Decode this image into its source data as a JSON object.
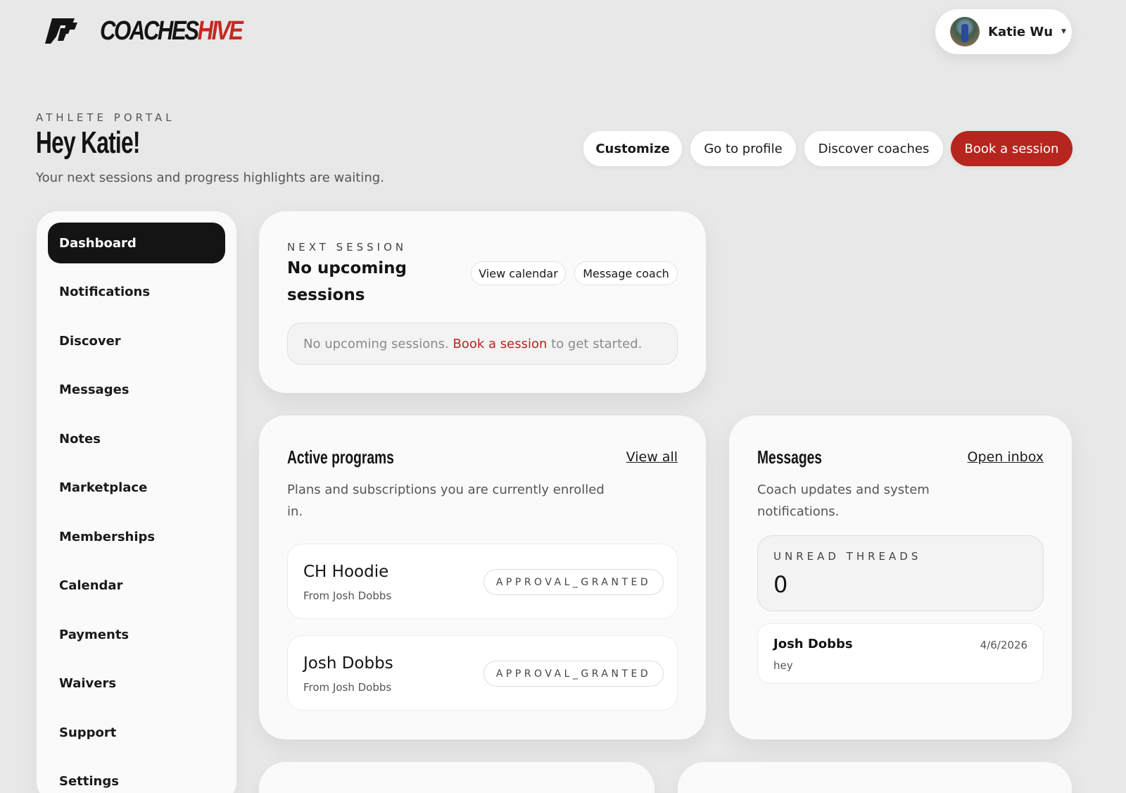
{
  "brand": {
    "word_dark": "COACHES",
    "word_accent": "HIVE",
    "accent_color": "#c22a22"
  },
  "user": {
    "name": "Katie Wu"
  },
  "header": {
    "eyebrow": "ATHLETE PORTAL",
    "greeting": "Hey Katie!",
    "subtitle": "Your next sessions and progress highlights are waiting."
  },
  "actions": {
    "customize": "Customize",
    "go_to_profile": "Go to profile",
    "discover_coaches": "Discover coaches",
    "book_session": "Book a session"
  },
  "sidebar": {
    "items": [
      {
        "label": "Dashboard",
        "active": true
      },
      {
        "label": "Notifications"
      },
      {
        "label": "Discover"
      },
      {
        "label": "Messages"
      },
      {
        "label": "Notes"
      },
      {
        "label": "Marketplace"
      },
      {
        "label": "Memberships"
      },
      {
        "label": "Calendar"
      },
      {
        "label": "Payments"
      },
      {
        "label": "Waivers"
      },
      {
        "label": "Support"
      },
      {
        "label": "Settings"
      }
    ]
  },
  "next_session": {
    "eyebrow": "NEXT SESSION",
    "title_line1": "No upcoming",
    "title_line2": "sessions",
    "view_calendar": "View calendar",
    "message_coach": "Message coach",
    "empty_prefix": "No upcoming sessions.",
    "empty_link": "Book a session",
    "empty_suffix": "to get started."
  },
  "programs": {
    "title": "Active programs",
    "view_all": "View all",
    "desc_line1": "Plans and subscriptions you are currently enrolled",
    "desc_line2": "in.",
    "items": [
      {
        "name": "CH Hoodie",
        "from": "From Josh Dobbs",
        "status": "APPROVAL_GRANTED"
      },
      {
        "name": "Josh Dobbs",
        "from": "From Josh Dobbs",
        "status": "APPROVAL_GRANTED"
      }
    ]
  },
  "messages": {
    "title": "Messages",
    "open_inbox": "Open inbox",
    "desc_line1": "Coach updates and system",
    "desc_line2": "notifications.",
    "unread_label": "UNREAD THREADS",
    "unread_count": "0",
    "threads": [
      {
        "name": "Josh Dobbs",
        "date": "4/6/2026",
        "preview": "hey"
      }
    ]
  }
}
